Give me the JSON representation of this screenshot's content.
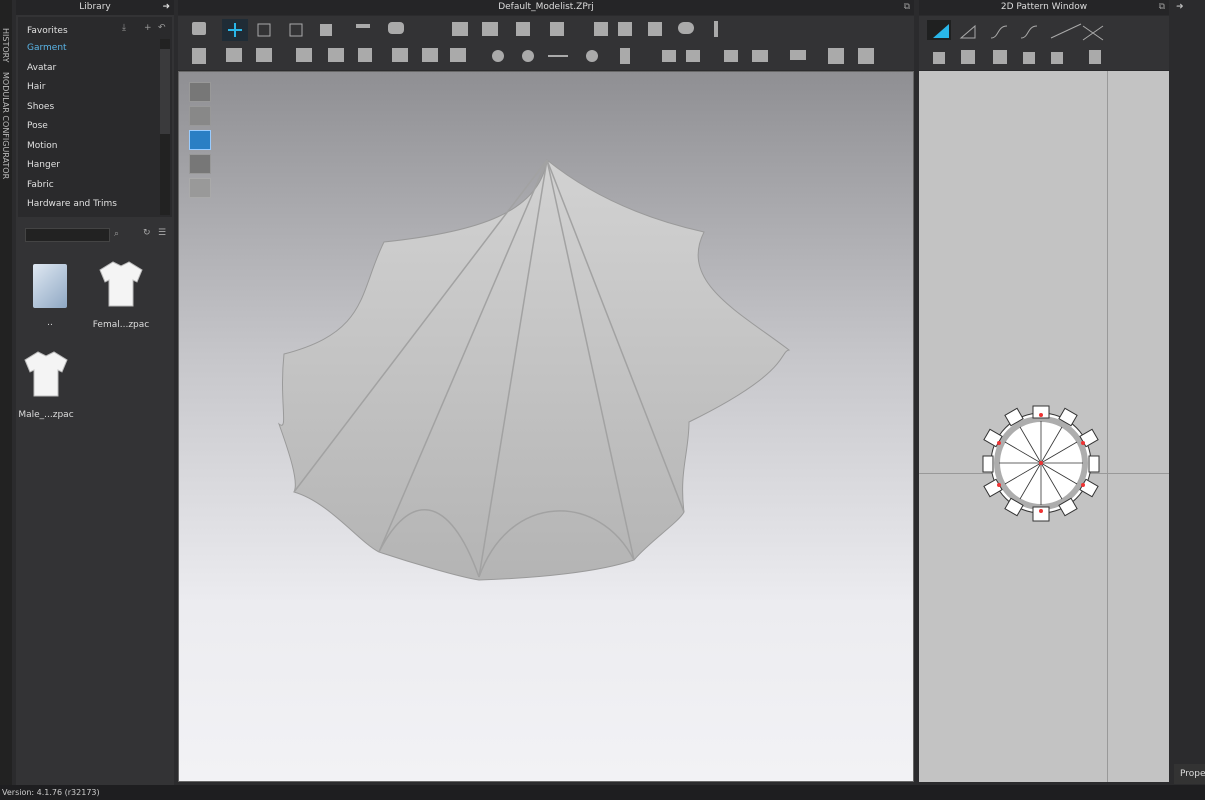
{
  "side_tabs": [
    "HISTORY",
    "MODULAR CONFIGURATOR"
  ],
  "library": {
    "title": "Library",
    "categories": [
      "Favorites",
      "Garment",
      "Avatar",
      "Hair",
      "Shoes",
      "Pose",
      "Motion",
      "Hanger",
      "Fabric",
      "Hardware and Trims"
    ],
    "selected": "Garment",
    "search_placeholder": "",
    "files": [
      {
        "name": "..",
        "icon": "folder-icon"
      },
      {
        "name": "Femal...zpac",
        "icon": "tshirt-icon"
      },
      {
        "name": "Male_...zpac",
        "icon": "tshirt-icon"
      }
    ]
  },
  "viewport": {
    "title": "Default_Modelist.ZPrj"
  },
  "pattern": {
    "title": "2D Pattern Window"
  },
  "properties_tab": "Prope",
  "status": {
    "version": "Version: 4.1.76 (r32173)"
  },
  "colors": {
    "accent": "#29b6e8",
    "selected_category": "#5ab4e6"
  }
}
